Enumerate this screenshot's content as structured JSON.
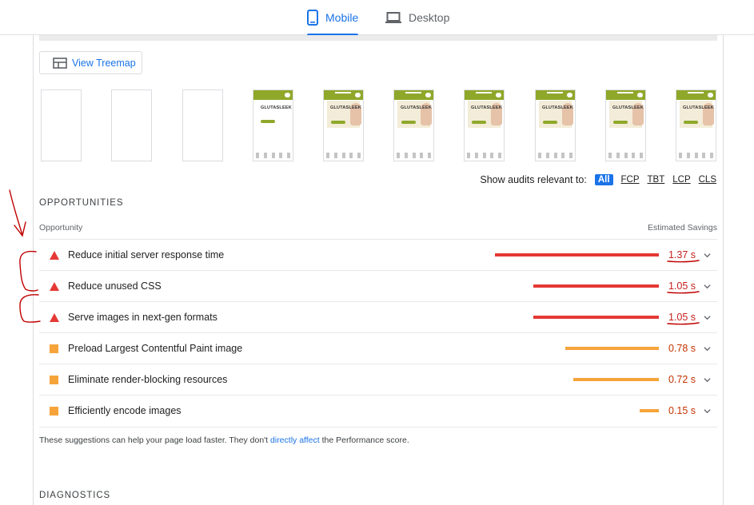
{
  "tabs": {
    "mobile": "Mobile",
    "desktop": "Desktop"
  },
  "treemap": {
    "label": "View Treemap"
  },
  "filmstrip": {
    "brand_text": "GLUTASLEEK"
  },
  "filters": {
    "label": "Show audits relevant to:",
    "items": [
      "All",
      "FCP",
      "TBT",
      "LCP",
      "CLS"
    ],
    "active": "All"
  },
  "opportunities": {
    "section_title": "OPPORTUNITIES",
    "col_opportunity": "Opportunity",
    "col_savings": "Estimated Savings",
    "items": [
      {
        "title": "Reduce initial server response time",
        "savings": "1.37 s",
        "severity": "fail",
        "fraction": 0.86
      },
      {
        "title": "Reduce unused CSS",
        "savings": "1.05 s",
        "severity": "fail",
        "fraction": 0.66
      },
      {
        "title": "Serve images in next-gen formats",
        "savings": "1.05 s",
        "severity": "fail",
        "fraction": 0.66
      },
      {
        "title": "Preload Largest Contentful Paint image",
        "savings": "0.78 s",
        "severity": "average",
        "fraction": 0.49
      },
      {
        "title": "Eliminate render-blocking resources",
        "savings": "0.72 s",
        "severity": "average",
        "fraction": 0.45
      },
      {
        "title": "Efficiently encode images",
        "savings": "0.15 s",
        "severity": "average",
        "fraction": 0.1
      }
    ]
  },
  "note": {
    "before": "These suggestions can help your page load faster. They don't ",
    "link": "directly affect",
    "after": " the Performance score."
  },
  "diagnostics": {
    "section_title": "DIAGNOSTICS"
  },
  "colors": {
    "accent": "#1a73e8",
    "fail": "#e53935",
    "average": "#f6a43a",
    "annotation": "#c00000"
  }
}
